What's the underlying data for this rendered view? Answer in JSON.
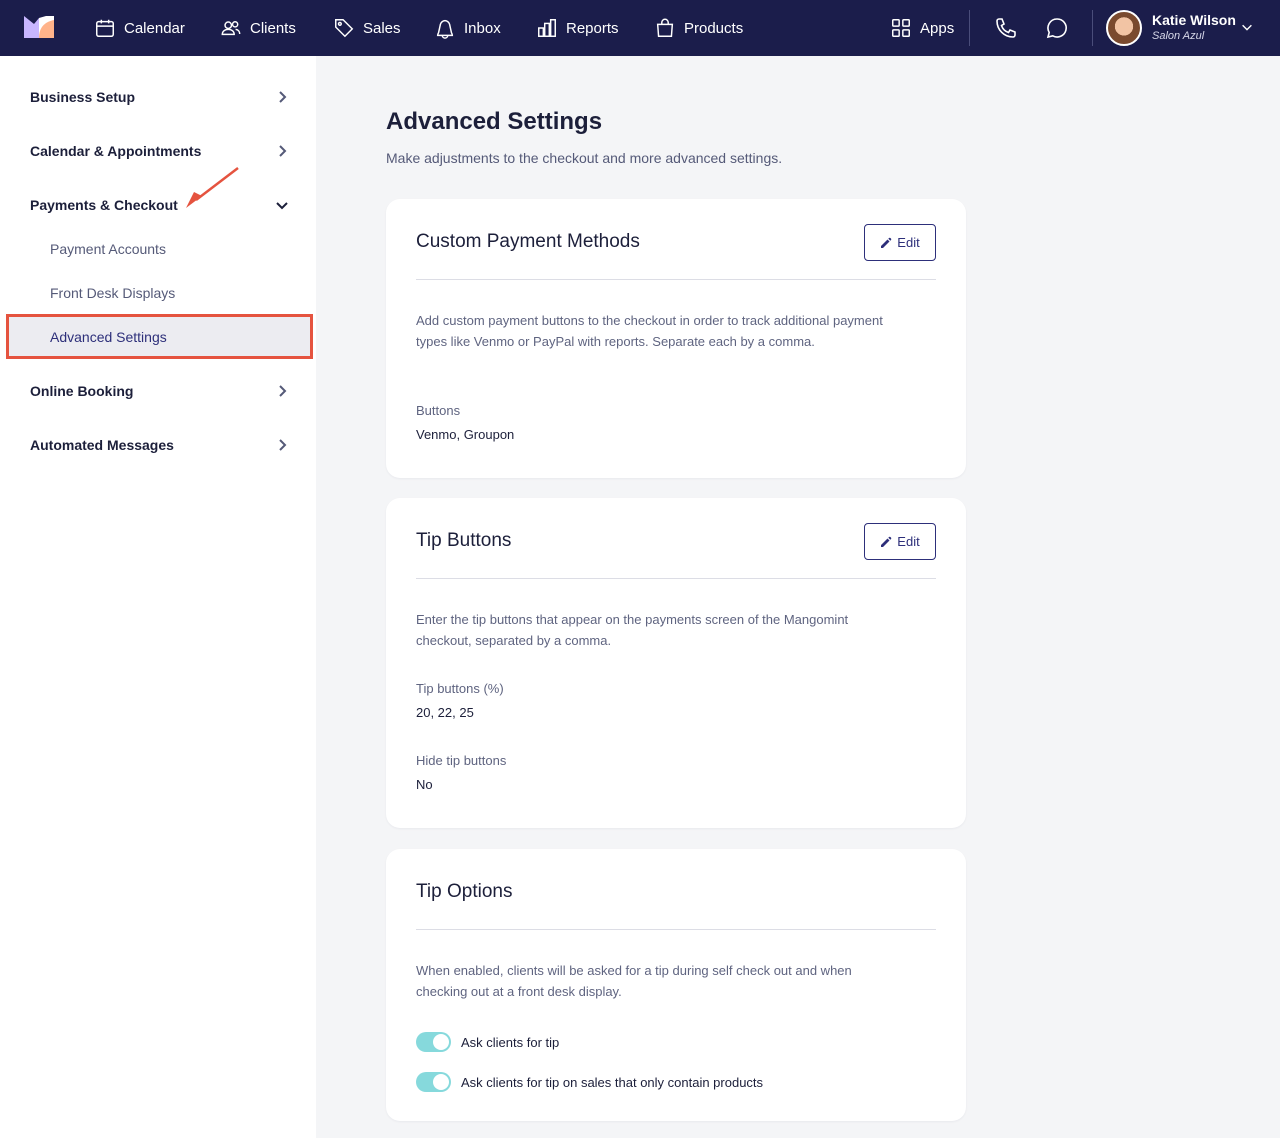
{
  "nav": {
    "items": [
      {
        "label": "Calendar",
        "icon": "calendar-icon"
      },
      {
        "label": "Clients",
        "icon": "clients-icon"
      },
      {
        "label": "Sales",
        "icon": "tag-icon"
      },
      {
        "label": "Inbox",
        "icon": "inbox-icon"
      },
      {
        "label": "Reports",
        "icon": "bar-chart-icon"
      },
      {
        "label": "Products",
        "icon": "shopping-bag-icon"
      }
    ],
    "apps_label": "Apps",
    "user": {
      "name": "Katie Wilson",
      "business": "Salon Azul"
    },
    "colors": {
      "bar": "#1b1d4b",
      "text": "#ffffff"
    }
  },
  "sidebar": {
    "sections": [
      {
        "label": "Business Setup",
        "expanded": false
      },
      {
        "label": "Calendar & Appointments",
        "expanded": false
      },
      {
        "label": "Payments & Checkout",
        "expanded": true
      },
      {
        "label": "Online Booking",
        "expanded": false
      },
      {
        "label": "Automated Messages",
        "expanded": false
      }
    ],
    "sub_items": [
      {
        "label": "Payment Accounts"
      },
      {
        "label": "Front Desk Displays"
      },
      {
        "label": "Advanced Settings",
        "active": true
      }
    ],
    "highlight_color": "#e5533f"
  },
  "main": {
    "title": "Advanced Settings",
    "subtitle": "Make adjustments to the checkout and more advanced settings.",
    "cards": [
      {
        "title": "Custom Payment Methods",
        "edit_label": "Edit",
        "description": "Add custom payment buttons to the checkout in order to track additional payment types like Venmo or PayPal with reports. Separate each by a comma.",
        "fields": [
          {
            "label": "Buttons",
            "value": "Venmo, Groupon"
          }
        ]
      },
      {
        "title": "Tip Buttons",
        "edit_label": "Edit",
        "description": "Enter the tip buttons that appear on the payments screen of the Mangomint checkout, separated by a comma.",
        "fields": [
          {
            "label": "Tip buttons (%)",
            "value": "20, 22, 25"
          },
          {
            "label": "Hide tip buttons",
            "value": "No"
          }
        ]
      },
      {
        "title": "Tip Options",
        "description": "When enabled, clients will be asked for a tip during self check out and when checking out at a front desk display.",
        "toggles": [
          {
            "label": "Ask clients for tip",
            "on": true
          },
          {
            "label": "Ask clients for tip on sales that only contain products",
            "on": true
          }
        ],
        "toggle_color": "#86d9dc"
      }
    ]
  }
}
